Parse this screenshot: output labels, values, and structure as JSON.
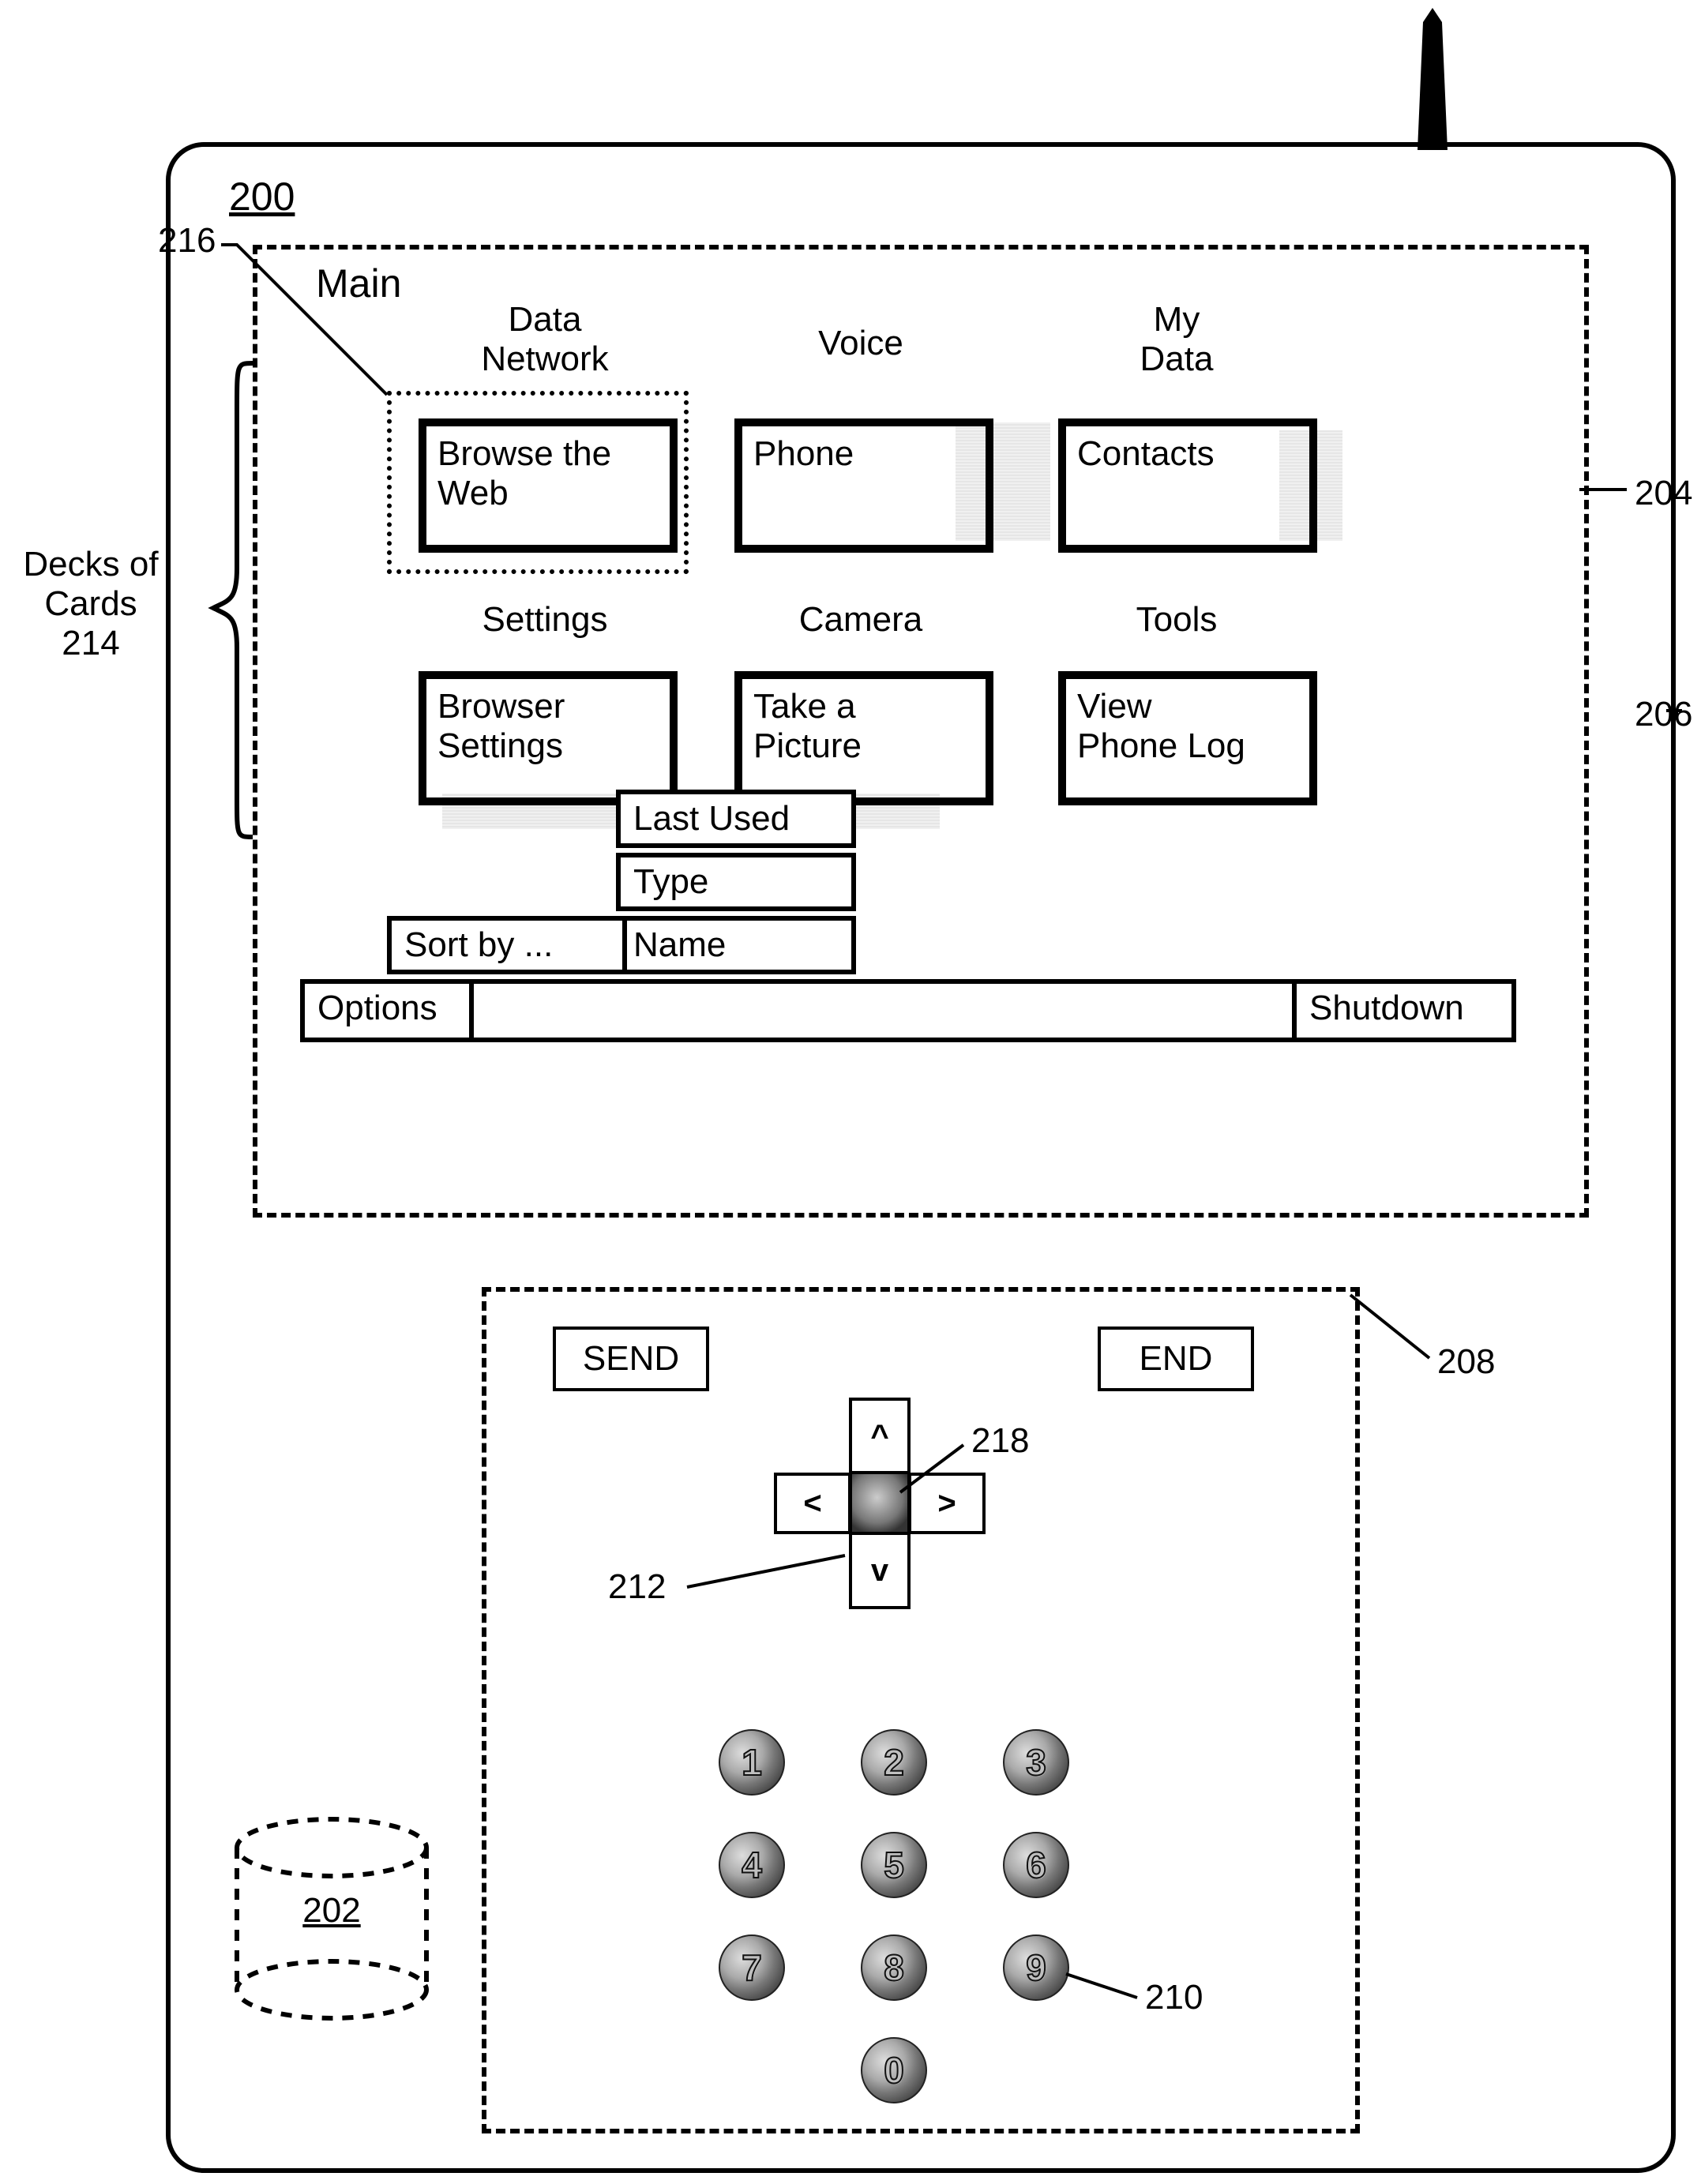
{
  "refs": {
    "r200": "200",
    "r202": "202",
    "r204": "204",
    "r206": "206",
    "r208": "208",
    "r210": "210",
    "r212": "212",
    "r214_line1": "Decks of",
    "r214_line2": "Cards",
    "r214_line3": "214",
    "r216": "216",
    "r218": "218"
  },
  "display": {
    "title": "Main",
    "columns": {
      "c0_l1": "Data",
      "c0_l2": "Network",
      "c1": "Voice",
      "c2_l1": "My",
      "c2_l2": "Data",
      "c3": "Settings",
      "c4": "Camera",
      "c5": "Tools"
    },
    "cards": {
      "browse_l1": "Browse the",
      "browse_l2": "Web",
      "phone": "Phone",
      "contacts": "Contacts",
      "browser_l1": "Browser",
      "browser_l2": "Settings",
      "take_l1": "Take a",
      "take_l2": "Picture",
      "viewlog_l1": "View",
      "viewlog_l2": "Phone Log"
    },
    "menu": {
      "last_used": "Last Used",
      "type": "Type",
      "name": "Name",
      "sort_by": "Sort by ...",
      "options": "Options",
      "shutdown": "Shutdown"
    }
  },
  "keypad_area": {
    "send": "SEND",
    "end": "END",
    "keys": {
      "k1": "1",
      "k2": "2",
      "k3": "3",
      "k4": "4",
      "k5": "5",
      "k6": "6",
      "k7": "7",
      "k8": "8",
      "k9": "9",
      "k0": "0"
    }
  }
}
